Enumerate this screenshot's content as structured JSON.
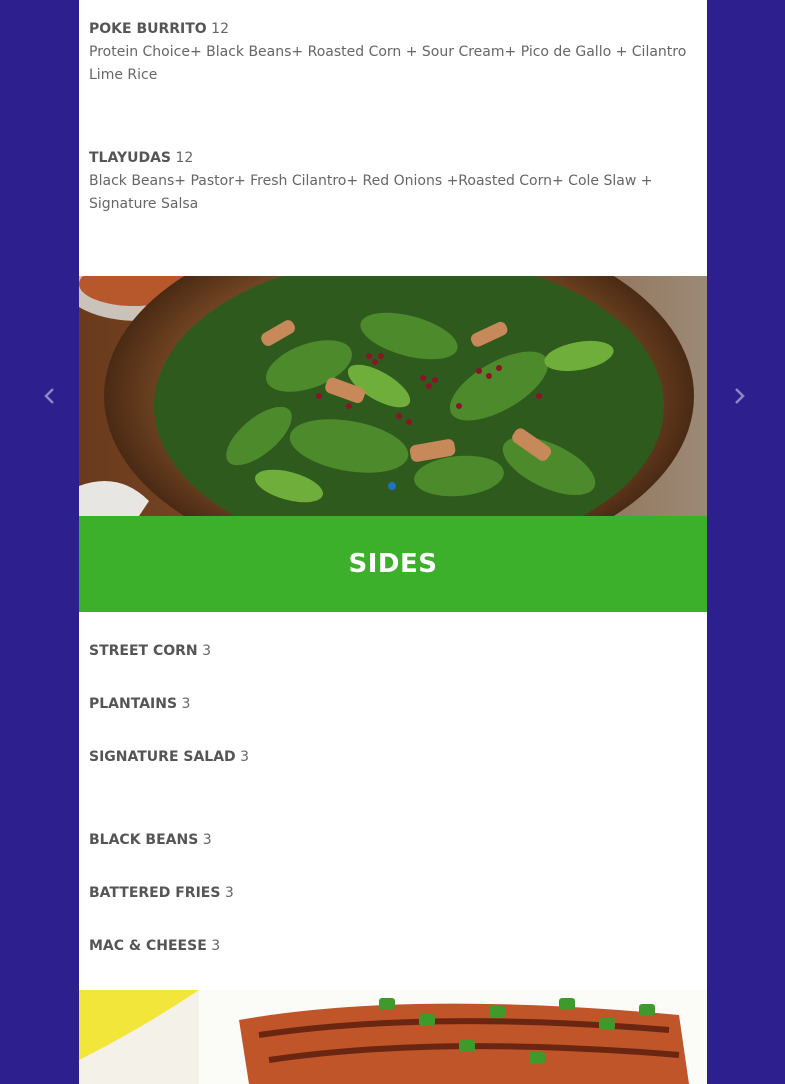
{
  "menu": {
    "items_top": [
      {
        "name": "POKE BURRITO",
        "price": "12",
        "description": "Protein Choice+ Black Beans+ Roasted Corn + Sour Cream+ Pico de Gallo + Cilantro Lime Rice"
      },
      {
        "name": "TLAYUDAS",
        "price": "12",
        "description": "Black Beans+ Pastor+ Fresh Cilantro+ Red Onions +Roasted Corn+ Cole Slaw + Signature Salsa"
      }
    ],
    "sides_title": "SIDES",
    "sides": [
      {
        "name": "STREET CORN",
        "price": "3"
      },
      {
        "name": "PLANTAINS",
        "price": "3"
      },
      {
        "name": "SIGNATURE SALAD",
        "price": "3"
      },
      {
        "name": "BLACK BEANS",
        "price": "3"
      },
      {
        "name": "BATTERED FRIES",
        "price": "3"
      },
      {
        "name": "MAC & CHEESE",
        "price": "3"
      }
    ]
  },
  "slider": {
    "prev_icon": "chevron-left-icon",
    "next_icon": "chevron-right-icon",
    "active_dot_color": "#1e73be"
  },
  "colors": {
    "background": "#2d1f8e",
    "banner": "#3cb02a",
    "content": "#ffffff"
  }
}
